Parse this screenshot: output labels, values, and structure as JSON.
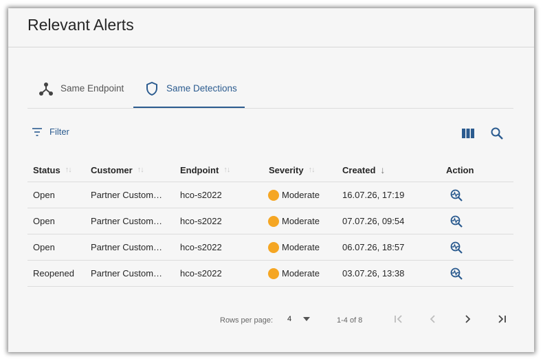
{
  "title": "Relevant Alerts",
  "tabs": [
    {
      "label": "Same Endpoint",
      "icon": "hub-icon",
      "active": false
    },
    {
      "label": "Same Detections",
      "icon": "shield-icon",
      "active": true
    }
  ],
  "toolbar": {
    "filter_label": "Filter"
  },
  "table": {
    "columns": [
      "Status",
      "Customer",
      "Endpoint",
      "Severity",
      "Created",
      "Action"
    ],
    "rows": [
      {
        "status": "Open",
        "customer": "Partner Custom…",
        "endpoint": "hco-s2022",
        "severity": "Moderate",
        "created": "16.07.26, 17:19"
      },
      {
        "status": "Open",
        "customer": "Partner Custom…",
        "endpoint": "hco-s2022",
        "severity": "Moderate",
        "created": "07.07.26, 09:54"
      },
      {
        "status": "Open",
        "customer": "Partner Custom…",
        "endpoint": "hco-s2022",
        "severity": "Moderate",
        "created": "06.07.26, 18:57"
      },
      {
        "status": "Reopened",
        "customer": "Partner Custom…",
        "endpoint": "hco-s2022",
        "severity": "Moderate",
        "created": "03.07.26, 13:38"
      }
    ]
  },
  "pagination": {
    "rows_per_page_label": "Rows per page:",
    "rows_per_page": "4",
    "range": "1-4 of 8"
  },
  "colors": {
    "accent": "#2b5b8f",
    "moderate": "#f5a623"
  }
}
